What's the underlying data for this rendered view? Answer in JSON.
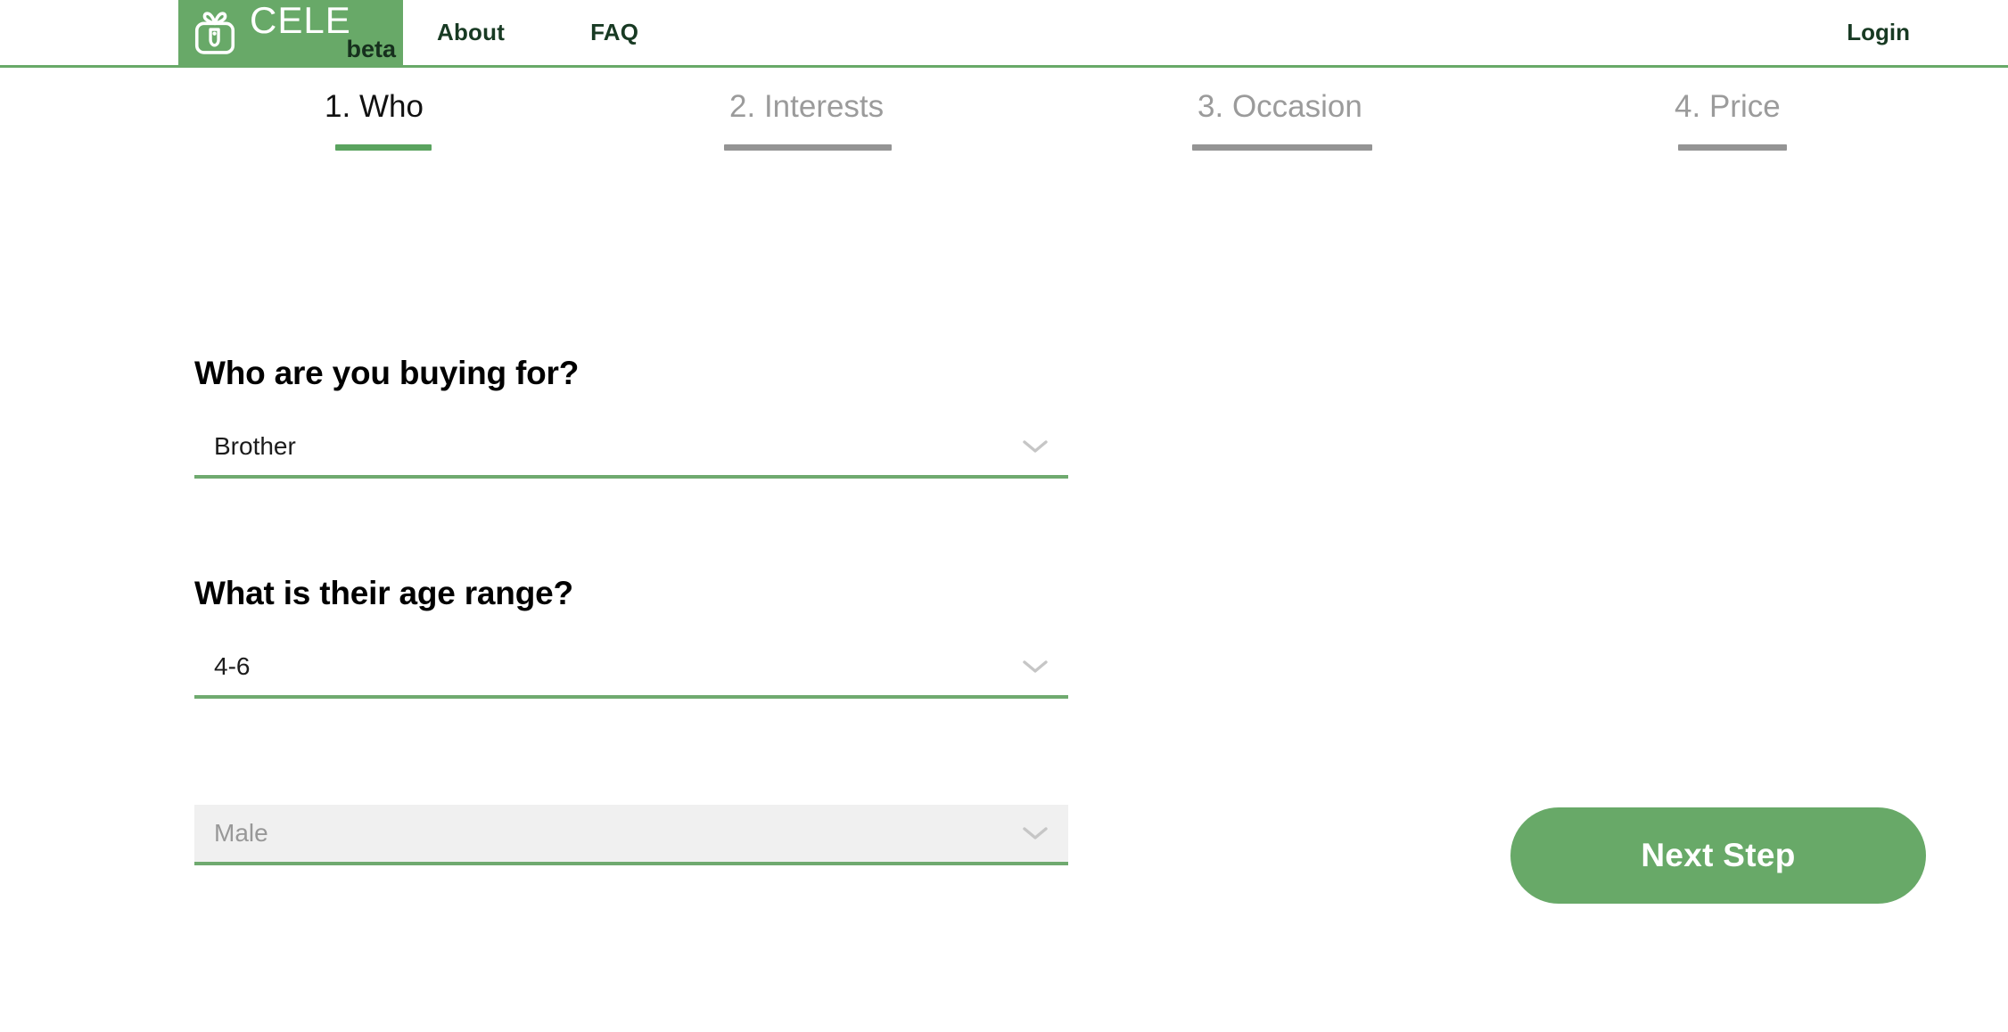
{
  "header": {
    "logo": {
      "icon": "gift-box-icon",
      "brand": "CELE",
      "tag": "beta",
      "background_color": "#68a968"
    },
    "nav": [
      {
        "label": "About",
        "name": "nav-link-about"
      },
      {
        "label": "FAQ",
        "name": "nav-link-faq"
      }
    ],
    "login_label": "Login",
    "border_color": "#68a968"
  },
  "stepper": {
    "active_index": 0,
    "steps": [
      {
        "number": "1.",
        "label": "Who",
        "state": "active"
      },
      {
        "number": "2.",
        "label": "Interests",
        "state": "inactive"
      },
      {
        "number": "3.",
        "label": "Occasion",
        "state": "inactive"
      },
      {
        "number": "4.",
        "label": "Price",
        "state": "inactive"
      }
    ],
    "active_color": "#5aa35f",
    "inactive_color": "#949494"
  },
  "form": {
    "who": {
      "heading": "Who are you buying for?",
      "value": "Brother",
      "icon": "chevron-down-icon",
      "state": "enabled"
    },
    "age": {
      "heading": "What is their age range?",
      "value": "4-6",
      "icon": "chevron-down-icon",
      "state": "enabled"
    },
    "gender": {
      "heading": "",
      "value": "Male",
      "icon": "chevron-down-icon",
      "state": "disabled"
    }
  },
  "actions": {
    "next_step_label": "Next Step",
    "next_step_color": "#68a968"
  }
}
